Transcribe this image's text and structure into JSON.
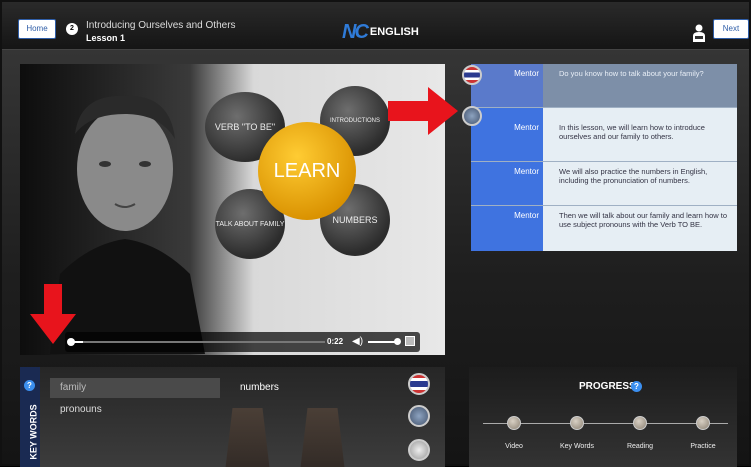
{
  "header": {
    "home_label": "Home",
    "lesson_number": "2",
    "lesson_title": "Introducing Ourselves and Others",
    "lesson_sub": "Lesson 1",
    "logo_mark": "NC",
    "logo_text": "ENGLISH",
    "next_label": "Next"
  },
  "video": {
    "bubbles": {
      "verb": "VERB \"TO BE\"",
      "introductions": "INTRODUCTIONS",
      "center": "LEARN",
      "family": "TALK ABOUT FAMILY",
      "numbers": "NUMBERS"
    },
    "time": "0:22",
    "progress_fraction": 0.05,
    "volume_fraction": 0.9
  },
  "mentor": {
    "rows": [
      {
        "label": "Mentor",
        "text": "Do you know how to talk about your family?"
      },
      {
        "label": "Mentor",
        "text": "In this lesson, we will learn how to introduce ourselves and our family to others."
      },
      {
        "label": "Mentor",
        "text": "We will also practice the numbers in English, including the pronunciation of numbers."
      },
      {
        "label": "Mentor",
        "text": "Then we will talk about our family and learn how to use subject pronouns with the Verb TO BE."
      }
    ]
  },
  "keywords": {
    "title": "KEY WORDS",
    "info": "?",
    "items": [
      "family",
      "pronouns",
      "numbers"
    ]
  },
  "progress": {
    "title": "PROGRESS",
    "info": "?",
    "steps": [
      "Video",
      "Key Words",
      "Reading",
      "Practice"
    ]
  },
  "colors": {
    "accent_blue": "#3f73e0",
    "arrow_red": "#e8141c",
    "learn_orange": "#f2b11c"
  }
}
